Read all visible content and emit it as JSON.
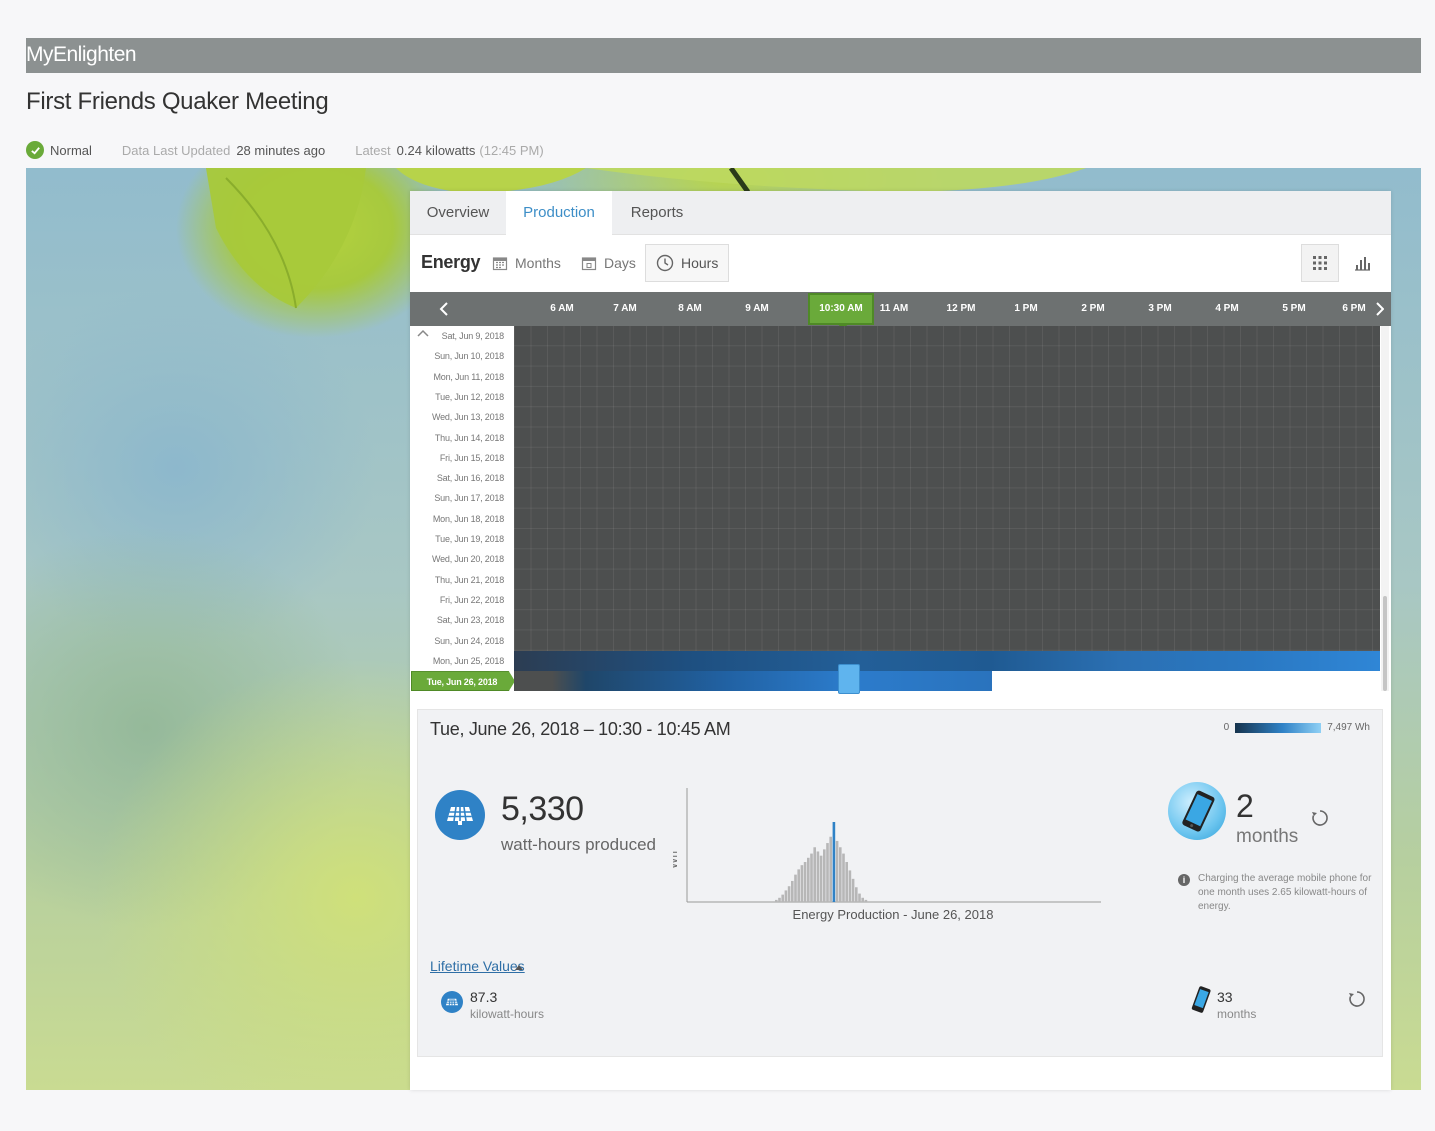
{
  "app": {
    "brand": "MyEnlighten"
  },
  "site": {
    "title": "First Friends Quaker Meeting"
  },
  "status": {
    "state": "Normal",
    "updated_label": "Data Last Updated",
    "updated_value": "28 minutes ago",
    "latest_label": "Latest",
    "latest_value": "0.24 kilowatts",
    "latest_time": "(12:45 PM)"
  },
  "tabs": [
    {
      "label": "Overview",
      "active": false
    },
    {
      "label": "Production",
      "active": true
    },
    {
      "label": "Reports",
      "active": false
    }
  ],
  "toolbar": {
    "energy_label": "Energy",
    "months_label": "Months",
    "days_label": "Days",
    "hours_label": "Hours",
    "selected_granularity": "Hours"
  },
  "timeline": {
    "hours": [
      "6 AM",
      "7 AM",
      "8 AM",
      "9 AM",
      "10:30 AM",
      "11 AM",
      "12 PM",
      "1 PM",
      "2 PM",
      "3 PM",
      "4 PM",
      "5 PM",
      "6 PM"
    ],
    "selected_hour": "10:30 AM",
    "days": [
      "Sat, Jun 9, 2018",
      "Sun, Jun 10, 2018",
      "Mon, Jun 11, 2018",
      "Tue, Jun 12, 2018",
      "Wed, Jun 13, 2018",
      "Thu, Jun 14, 2018",
      "Fri, Jun 15, 2018",
      "Sat, Jun 16, 2018",
      "Sun, Jun 17, 2018",
      "Mon, Jun 18, 2018",
      "Tue, Jun 19, 2018",
      "Wed, Jun 20, 2018",
      "Thu, Jun 21, 2018",
      "Fri, Jun 22, 2018",
      "Sat, Jun 23, 2018",
      "Sun, Jun 24, 2018",
      "Mon, Jun 25, 2018",
      "Tue, Jun 26, 2018"
    ],
    "selected_day": "Tue, Jun 26, 2018"
  },
  "detail": {
    "title": "Tue, June 26, 2018 – 10:30 - 10:45 AM",
    "legend_min": "0",
    "legend_max": "7,497 Wh",
    "produced_value": "5,330",
    "produced_label": "watt-hours produced",
    "chart_ylabel": "Wh",
    "chart_caption": "Energy Production - June 26, 2018",
    "months_value": "2",
    "months_label": "months",
    "info_text": "Charging the average mobile phone for one month uses 2.65 kilowatt-hours of energy."
  },
  "lifetime": {
    "link_label": "Lifetime Values",
    "energy_value": "87.3",
    "energy_unit": "kilowatt-hours",
    "months_value": "33",
    "months_unit": "months"
  },
  "colors": {
    "accent": "#3d8ec7",
    "selected_green": "#6aaa3a",
    "solar_blue": "#2f82c6"
  },
  "chart_data": {
    "type": "bar",
    "title": "Energy Production - June 26, 2018",
    "ylabel": "Wh",
    "values": [
      2,
      4,
      7,
      11,
      15,
      20,
      26,
      31,
      35,
      38,
      42,
      46,
      52,
      48,
      44,
      50,
      56,
      62,
      76,
      58,
      52,
      46,
      38,
      30,
      22,
      14,
      8,
      4,
      2
    ],
    "highlight_index": 18
  }
}
